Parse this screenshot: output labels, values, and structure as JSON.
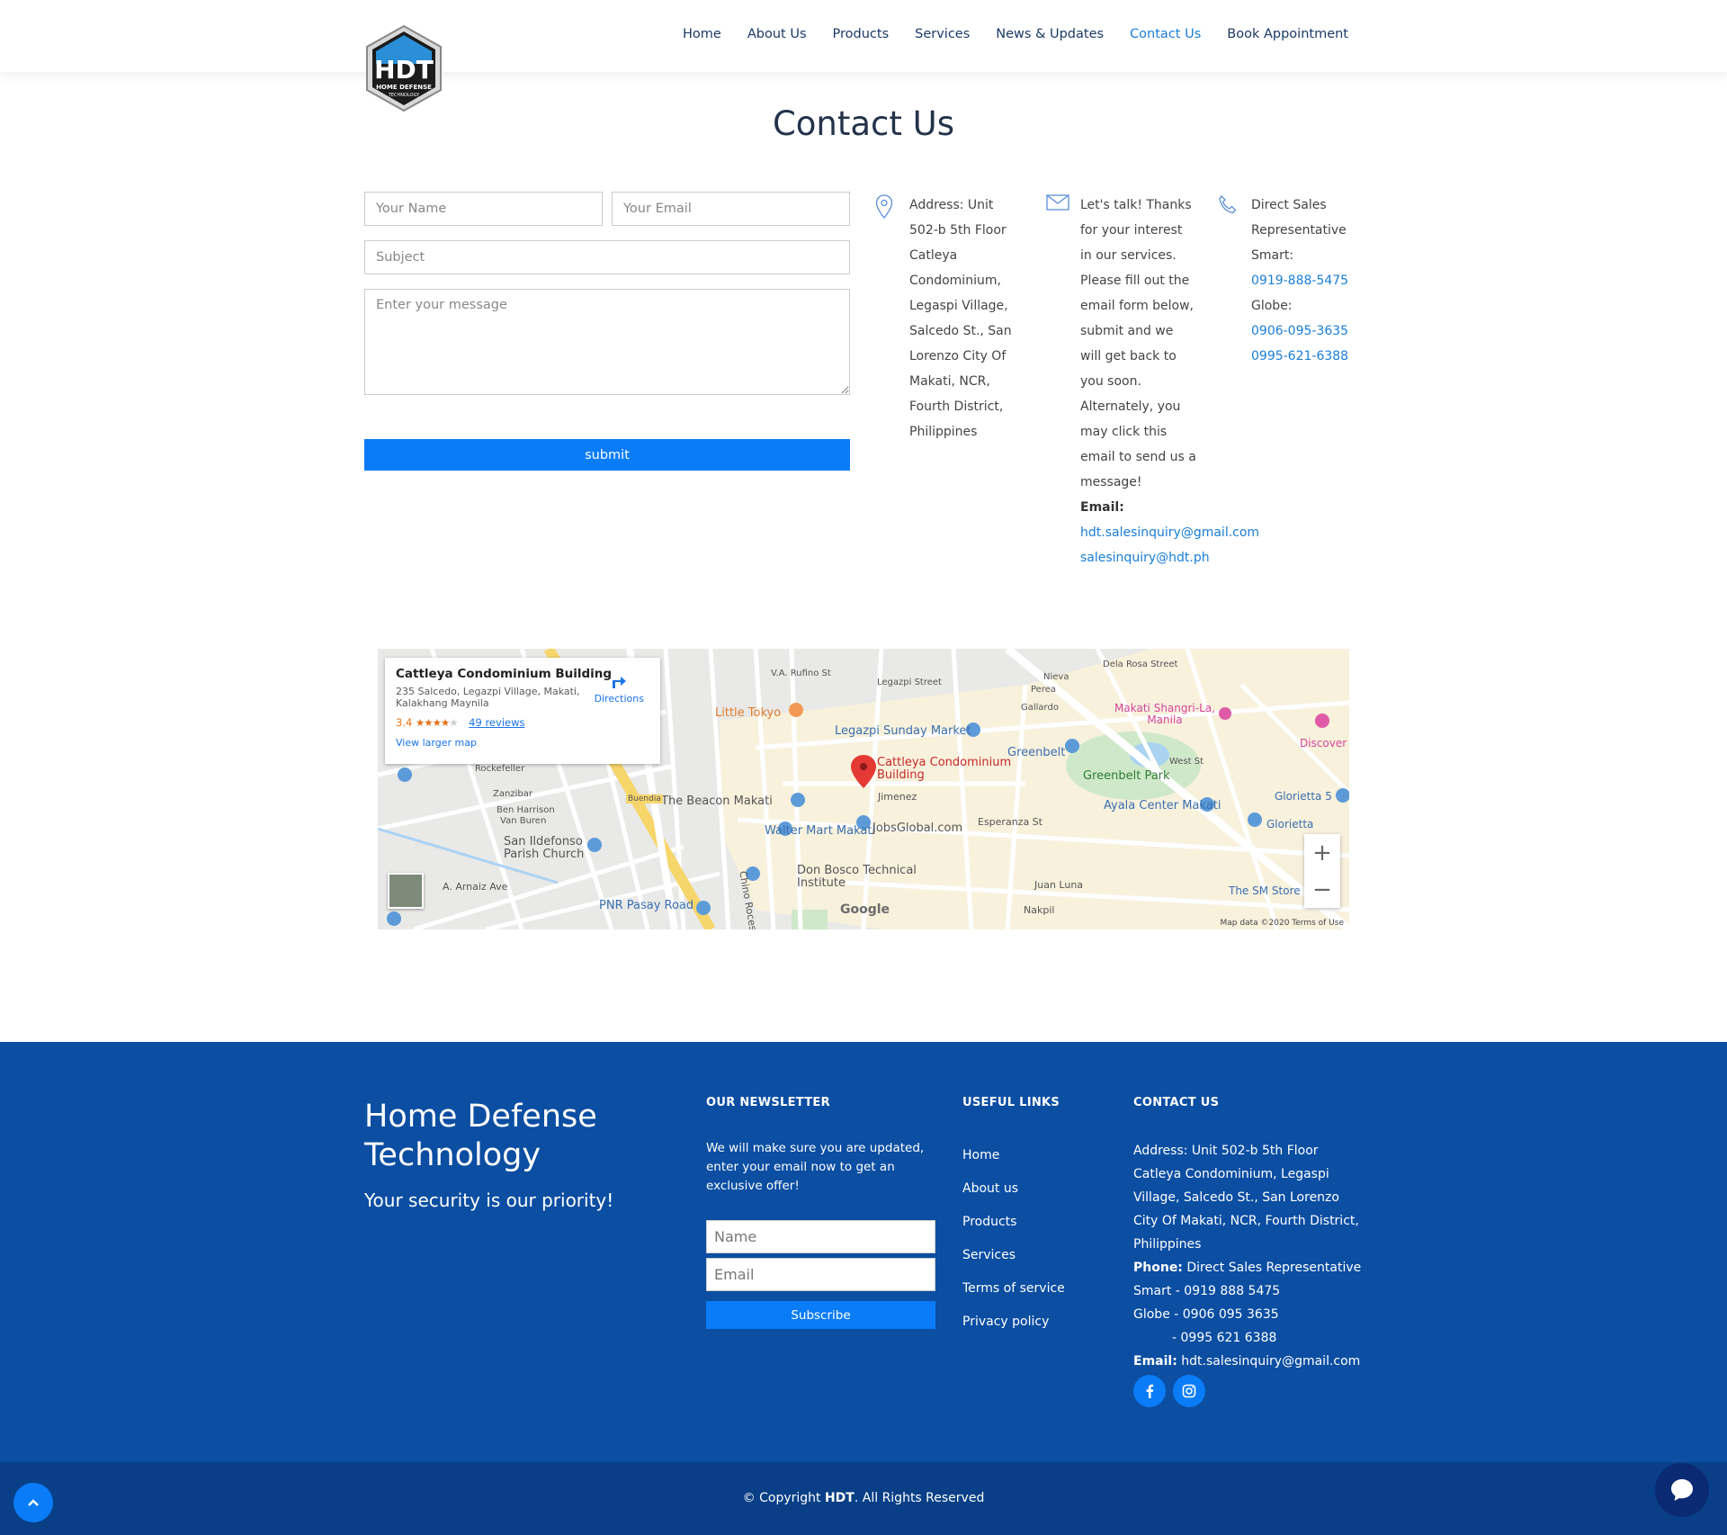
{
  "nav": {
    "items": [
      "Home",
      "About Us",
      "Products",
      "Services",
      "News & Updates",
      "Contact Us",
      "Book Appointment"
    ]
  },
  "logo": {
    "text": "HDT",
    "subtext": "HOME DEFENSE TECHNOLOGY"
  },
  "page_title": "Contact Us",
  "form": {
    "name_placeholder": "Your Name",
    "email_placeholder": "Your Email",
    "subject_placeholder": "Subject",
    "message_placeholder": "Enter your message",
    "submit_label": "submit"
  },
  "info": {
    "address": "Address: Unit 502-b 5th Floor Catleya Condominium, Legaspi Village, Salcedo St., San Lorenzo City Of Makati, NCR, Fourth District, Philippines",
    "talk_text": "Let's talk! Thanks for your interest in our services. Please fill out the email form below, submit and we will get back to you soon. Alternately, you may click this email to send us a message!",
    "email_label": "Email:",
    "emails": [
      "hdt.salesinquiry@gmail.com",
      "salesinquiry@hdt.ph"
    ],
    "phone_intro": "Direct Sales Representative",
    "smart_label": "Smart:",
    "smart_number": "0919-888-5475",
    "globe_label": "Globe:",
    "globe_numbers": [
      "0906-095-3635",
      "0995-621-6388"
    ]
  },
  "map": {
    "place_name": "Cattleya Condominium Building",
    "place_address": "235 Salcedo, Legazpi Village, Makati, Kalakhang Maynila",
    "rating": "3.4",
    "reviews": "49 reviews",
    "view_larger": "View larger map",
    "directions": "Directions",
    "pin_label": "Cattleya Condominium Building",
    "labels": [
      "Little Tokyo",
      "Legazpi Sunday Market",
      "Greenbelt",
      "Greenbelt Park",
      "Makati Shangri-La, Manila",
      "Discover",
      "Glorietta 5",
      "Glorietta",
      "Ayala Center Makati",
      "The Beacon Makati",
      "Walter Mart Makati",
      "JobsGlobal.com",
      "San Ildefonso Parish Church",
      "Don Bosco Technical Institute",
      "PNR Pasay Road",
      "The SM Store",
      "Esperanza St",
      "Juan Luna",
      "Nakpil",
      "Jimenez",
      "Buendia",
      "Ben Harrison",
      "Van Buren",
      "Zanzibar",
      "Rockefeller",
      "A. Arnaiz Ave",
      "Chino Roces Av",
      "V.A. Rufino St",
      "Gallardo",
      "Perea",
      "Nieva",
      "Dela Rosa Street",
      "Legazpi Street",
      "West St"
    ],
    "footer": "Map data ©2020   Terms of Use",
    "google": "Google"
  },
  "footer": {
    "brand": "Home Defense Technology",
    "tagline": "Your security is our priority!",
    "newsletter_heading": "OUR NEWSLETTER",
    "newsletter_text": "We will make sure you are updated, enter your email now to get an exclusive offer!",
    "newsletter_name_placeholder": "Name",
    "newsletter_email_placeholder": "Email",
    "subscribe_label": "Subscribe",
    "links_heading": "USEFUL LINKS",
    "links": [
      "Home",
      "About us",
      "Products",
      "Services",
      "Terms of service",
      "Privacy policy"
    ],
    "contact_heading": "CONTACT US",
    "contact_address": "Address: Unit 502-b 5th Floor Catleya Condominium, Legaspi Village, Salcedo St., San Lorenzo City Of Makati, NCR, Fourth District, Philippines",
    "phone_label": "Phone:",
    "phone_text": "Direct Sales Representative",
    "smart_line": "Smart - 0919 888 5475",
    "globe_line": "Globe - 0906 095 3635",
    "globe_line2": "- 0995 621 6388",
    "email_label": "Email:",
    "email_value": "hdt.salesinquiry@gmail.com",
    "copyright_pre": "© Copyright ",
    "copyright_brand": "HDT",
    "copyright_post": ". All Rights Reserved"
  },
  "colors": {
    "accent": "#0a7cf8",
    "footer_bg": "#0b4ea2",
    "copy_bg": "#083f86",
    "link": "#1a7ed6"
  }
}
